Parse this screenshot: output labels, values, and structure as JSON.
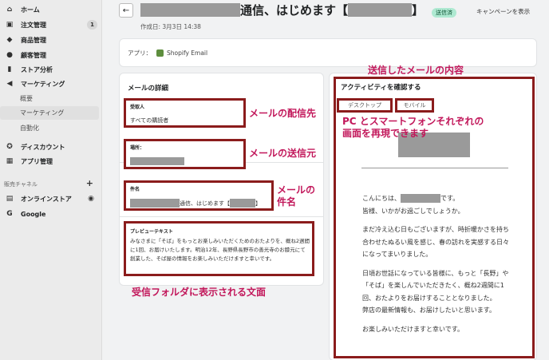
{
  "sidebar": {
    "items": [
      {
        "label": "ホーム",
        "icon": "home-icon",
        "glyph": "⌂"
      },
      {
        "label": "注文管理",
        "icon": "orders-icon",
        "glyph": "▣",
        "count": "1"
      },
      {
        "label": "商品管理",
        "icon": "tag-icon",
        "glyph": "◆"
      },
      {
        "label": "顧客管理",
        "icon": "person-icon",
        "glyph": "●"
      },
      {
        "label": "ストア分析",
        "icon": "chart-icon",
        "glyph": "▮"
      },
      {
        "label": "マーケティング",
        "icon": "megaphone-icon",
        "glyph": "◀"
      }
    ],
    "marketing_sub": [
      "概要",
      "マーケティング",
      "自動化"
    ],
    "items2": [
      {
        "label": "ディスカウント",
        "icon": "discount-icon",
        "glyph": "✪"
      },
      {
        "label": "アプリ管理",
        "icon": "apps-icon",
        "glyph": "▦"
      }
    ],
    "sales_channel_label": "販売チャネル",
    "channels": [
      {
        "label": "オンラインストア",
        "icon": "store-icon",
        "glyph": "▤"
      },
      {
        "label": "Google",
        "icon": "google-icon",
        "glyph": "G"
      }
    ]
  },
  "header": {
    "title_mid": "通信、はじめます【",
    "title_end": "】",
    "status": "送信済",
    "campaign_link": "キャンペーンを表示",
    "created": "作成日: 3月3日 14:38"
  },
  "app": {
    "label": "アプリ：",
    "name": "Shopify Email"
  },
  "details": {
    "title": "メールの詳細",
    "recipient_label": "受取人",
    "recipient_value": "すべての購読者",
    "location_label": "場所：",
    "subject_label": "件名",
    "subject_value": "通信、はじめます【",
    "subject_end": "】",
    "preview_label": "プレビューテキスト",
    "preview_value": "みなさまに「そば」をもっとお楽しみいただくためのおたよりを、概ね2週間に1回、お届けいたします。明治12年、長野県長野市の善光寺のお膝元にて創業した、そば屋の情報をお楽しみいただけますと幸いです。"
  },
  "preview": {
    "title": "アクティビティを確認する",
    "tab_desktop": "デスクトップ",
    "tab_mobile": "モバイル",
    "greeting_pre": "こんにちは、",
    "greeting_post": "です。",
    "line2": "皆様、いかがお過ごしでしょうか。",
    "para2": "まだ冷え込む日もございますが、時折暖かさを持ち合わせたぬるい風を感じ、春の訪れを実感する日々になってまいりました。",
    "para3": "日頃お世話になっている皆様に、もっと「長野」や「そば」を楽しんでいただきたく、概ね2週間に1回、おたよりをお届けすることとなりました。",
    "para4": "弊店の最新情報も、お届けしたいと思います。",
    "para5": "お楽しみいただけますと幸いです。"
  },
  "annotations": {
    "content": "送信したメールの内容",
    "recipient": "メールの配信先",
    "sender": "メールの送信元",
    "pc_line1": "PC とスマートフォンそれぞれの",
    "pc_line2": "画面を再現できます",
    "subject_line1": "メールの",
    "subject_line2": "件名",
    "inbox": "受信フォルダに表示される文面"
  },
  "colors": {
    "annotation": "#c2185b",
    "highlight_border": "#8b1c1c",
    "status_badge": "#aee9d1"
  }
}
